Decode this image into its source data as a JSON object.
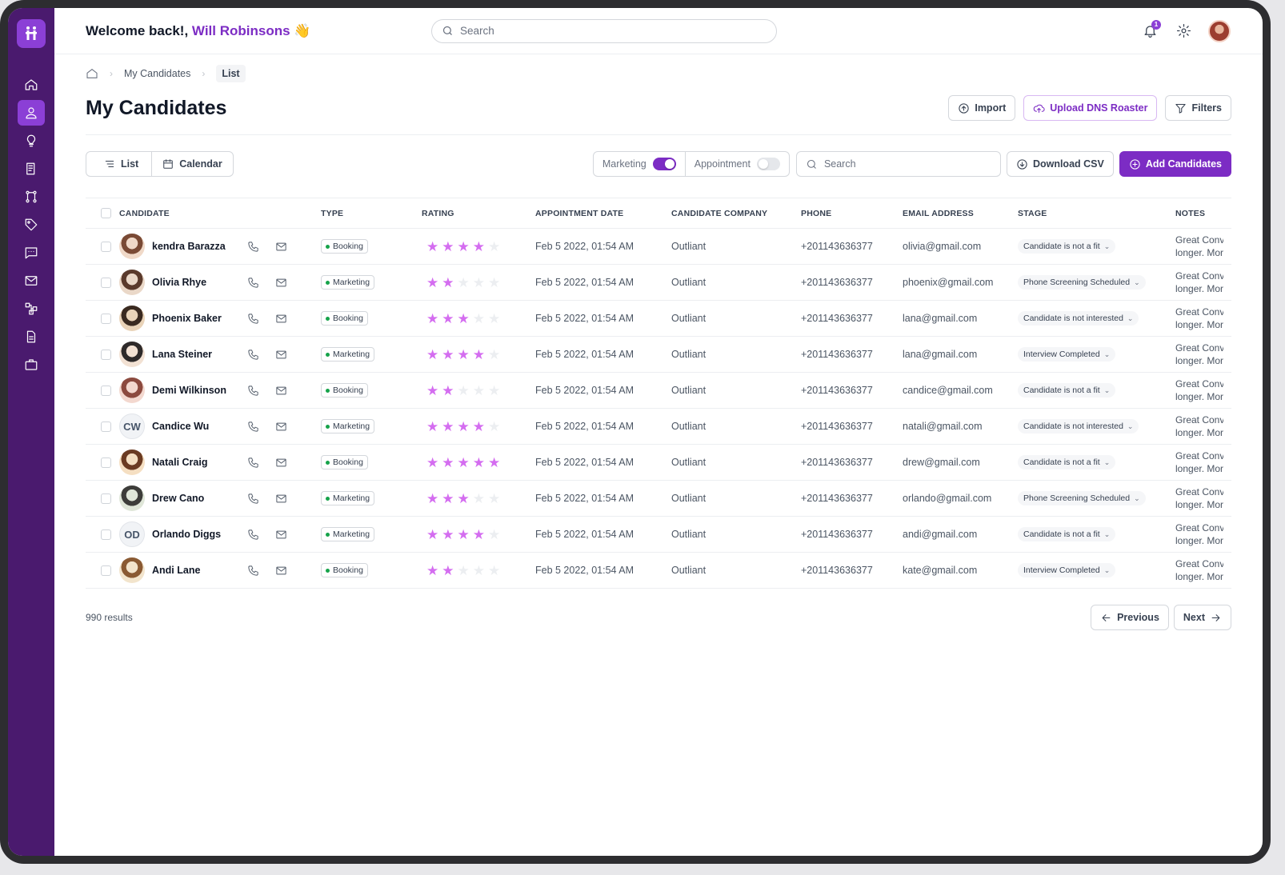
{
  "topbar": {
    "welcome_prefix": "Welcome back!,",
    "user_name": "Will Robinsons",
    "wave": "👋",
    "search_placeholder": "Search",
    "notification_count": "1"
  },
  "breadcrumb": {
    "items": [
      "My Candidates",
      "List"
    ]
  },
  "page": {
    "title": "My Candidates",
    "import_label": "Import",
    "upload_label": "Upload DNS Roaster",
    "filters_label": "Filters"
  },
  "toolbar": {
    "list_label": "List",
    "calendar_label": "Calendar",
    "marketing_label": "Marketing",
    "marketing_on": true,
    "appointment_label": "Appointment",
    "appointment_on": false,
    "search_placeholder": "Search",
    "download_label": "Download CSV",
    "add_label": "Add Candidates"
  },
  "table": {
    "headers": [
      "CANDIDATE",
      "TYPE",
      "RATING",
      "APPOINTMENT DATE",
      "CANDIDATE COMPANY",
      "PHONE",
      "EMAIL ADDRESS",
      "STAGE",
      "NOTES"
    ],
    "rows": [
      {
        "name": "kendra Barazza",
        "initials": "",
        "type": "Booking",
        "rating": 4,
        "date": "Feb 5 2022, 01:54 AM",
        "company": "Outliant",
        "phone": "+201143636377",
        "email": "olivia@gmail.com",
        "stage": "Candidate is not a fit",
        "notes1": "Great Conv",
        "notes2": "longer. Mor"
      },
      {
        "name": "Olivia Rhye",
        "initials": "",
        "type": "Marketing",
        "rating": 2,
        "date": "Feb 5 2022, 01:54 AM",
        "company": "Outliant",
        "phone": "+201143636377",
        "email": "phoenix@gmail.com",
        "stage": "Phone Screening Scheduled",
        "notes1": "Great Conv",
        "notes2": "longer. Mor"
      },
      {
        "name": "Phoenix Baker",
        "initials": "",
        "type": "Booking",
        "rating": 3,
        "date": "Feb 5 2022, 01:54 AM",
        "company": "Outliant",
        "phone": "+201143636377",
        "email": "lana@gmail.com",
        "stage": "Candidate is not interested",
        "notes1": "Great Conv",
        "notes2": "longer. Mor"
      },
      {
        "name": "Lana Steiner",
        "initials": "",
        "type": "Marketing",
        "rating": 4,
        "date": "Feb 5 2022, 01:54 AM",
        "company": "Outliant",
        "phone": "+201143636377",
        "email": "lana@gmail.com",
        "stage": "Interview Completed",
        "notes1": "Great Conv",
        "notes2": "longer. Mor"
      },
      {
        "name": "Demi Wilkinson",
        "initials": "",
        "type": "Booking",
        "rating": 2,
        "date": "Feb 5 2022, 01:54 AM",
        "company": "Outliant",
        "phone": "+201143636377",
        "email": "candice@gmail.com",
        "stage": "Candidate is not a fit",
        "notes1": "Great Conv",
        "notes2": "longer. Mor"
      },
      {
        "name": "Candice Wu",
        "initials": "CW",
        "type": "Marketing",
        "rating": 4,
        "date": "Feb 5 2022, 01:54 AM",
        "company": "Outliant",
        "phone": "+201143636377",
        "email": "natali@gmail.com",
        "stage": "Candidate is not interested",
        "notes1": "Great Conv",
        "notes2": "longer. Mor"
      },
      {
        "name": "Natali Craig",
        "initials": "",
        "type": "Booking",
        "rating": 5,
        "date": "Feb 5 2022, 01:54 AM",
        "company": "Outliant",
        "phone": "+201143636377",
        "email": "drew@gmail.com",
        "stage": "Candidate is not a fit",
        "notes1": "Great Conv",
        "notes2": "longer. Mor"
      },
      {
        "name": "Drew Cano",
        "initials": "",
        "type": "Marketing",
        "rating": 3,
        "date": "Feb 5 2022, 01:54 AM",
        "company": "Outliant",
        "phone": "+201143636377",
        "email": "orlando@gmail.com",
        "stage": "Phone Screening Scheduled",
        "notes1": "Great Conv",
        "notes2": "longer. Mor"
      },
      {
        "name": "Orlando Diggs",
        "initials": "OD",
        "type": "Marketing",
        "rating": 4,
        "date": "Feb 5 2022, 01:54 AM",
        "company": "Outliant",
        "phone": "+201143636377",
        "email": "andi@gmail.com",
        "stage": "Candidate is not a fit",
        "notes1": "Great Conv",
        "notes2": "longer. Mor"
      },
      {
        "name": "Andi Lane",
        "initials": "",
        "type": "Booking",
        "rating": 2,
        "date": "Feb 5 2022, 01:54 AM",
        "company": "Outliant",
        "phone": "+201143636377",
        "email": "kate@gmail.com",
        "stage": "Interview Completed",
        "notes1": "Great Conv",
        "notes2": "longer. Mor"
      }
    ]
  },
  "footer": {
    "results": "990 results",
    "previous_label": "Previous",
    "next_label": "Next"
  },
  "colors": {
    "sidebar": "#4a1a6e",
    "accent": "#7c2cc4",
    "star_on": "#d46df0",
    "star_off": "#eceef1"
  },
  "sidebar_icons": [
    "home-icon",
    "user-icon",
    "lightbulb-icon",
    "book-icon",
    "git-branch-icon",
    "tag-icon",
    "message-icon",
    "mail-icon",
    "workflow-icon",
    "document-icon",
    "briefcase-icon"
  ]
}
